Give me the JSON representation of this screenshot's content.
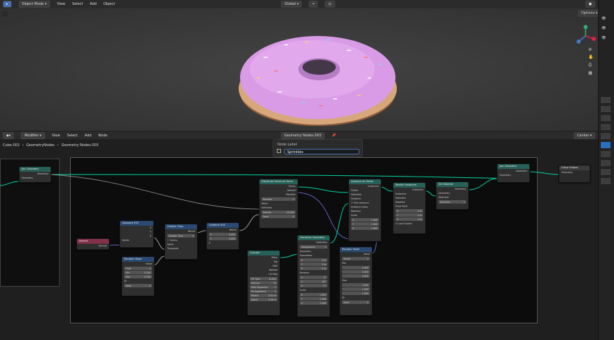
{
  "top_header": {
    "mode": "Object Mode",
    "menus": [
      "View",
      "Select",
      "Add",
      "Object"
    ],
    "transform": "Global",
    "options": "Options"
  },
  "node_header": {
    "editor": "Modifier",
    "menus": [
      "View",
      "Select",
      "Add",
      "Node"
    ],
    "tree_name": "Geometry Nodes.003",
    "pivot": "Center"
  },
  "breadcrumb": [
    "Cube.002",
    "GeometryNodes",
    "Geometry Nodes.003"
  ],
  "node_label_popup": {
    "title": "Node Label",
    "value": "Sprinkles"
  },
  "nodes": {
    "join1": {
      "title": "Join Geometry",
      "out": "Geometry",
      "in": "Geometry"
    },
    "normal": {
      "title": "Normal",
      "out": "Normal"
    },
    "sepxyz": {
      "title": "Separate XYZ",
      "outs": [
        "X",
        "Y",
        "Z"
      ],
      "in": "Vector"
    },
    "greater": {
      "title": "Greater Than",
      "out": "Result",
      "mode": "Greater Than",
      "clamp": "Clamp",
      "ins": [
        "Value",
        "Threshold"
      ]
    },
    "combine": {
      "title": "Combine XYZ",
      "out": "Vector",
      "x": "X",
      "xv": "0.000",
      "y": "Y",
      "yv": "0.000",
      "z": "Z"
    },
    "random": {
      "title": "Random Value",
      "out": "Value",
      "type": "Float",
      "min": "Min",
      "minv": "0.200",
      "max": "Max",
      "maxv": "0.500",
      "id": "ID",
      "seed": "Seed",
      "seedv": "0"
    },
    "distribute": {
      "title": "Distribute Points on Faces",
      "outs": [
        "Points",
        "Normal",
        "Rotation"
      ],
      "mode": "Random",
      "ins": [
        "Mesh",
        "Selection"
      ],
      "density": "Density",
      "densityv": "20.000",
      "seed": "Seed",
      "seedv": "0"
    },
    "cylinder": {
      "title": "Cylinder",
      "outs": [
        "Mesh",
        "Top",
        "Side",
        "Bottom",
        "UV Map"
      ],
      "fill": "Fill Type",
      "fillv": "N-Gon",
      "vertices": "Vertices",
      "verticesv": "10",
      "sides": "Side Segments",
      "sidesv": "1",
      "fillseg": "Fill Segments",
      "fillsegv": "1",
      "radius": "Radius",
      "radiusv": "0.01 m",
      "depth": "Depth",
      "depthv": "0.09 m"
    },
    "transform": {
      "title": "Transform Geometry",
      "out": "Geometry",
      "mode": "Components",
      "in": "Geometry",
      "translation": "Translation",
      "t": [
        "0 m",
        "0 m",
        "0 m"
      ],
      "rotation": "Rotation",
      "r": [
        "0°",
        "90°",
        "0°"
      ],
      "scale": "Scale",
      "s": [
        "1.000",
        "1.000",
        "1.000"
      ],
      "axes": [
        "X",
        "Y",
        "Z"
      ]
    },
    "instance": {
      "title": "Instance on Points",
      "out": "Instances",
      "ins": [
        "Points",
        "Selection",
        "Instance",
        "Pick Instance",
        "Instance Index",
        "Rotation",
        "Scale"
      ],
      "scale": [
        "1.000",
        "1.000",
        "1.000"
      ]
    },
    "random2": {
      "title": "Random Value",
      "out": "Value",
      "type": "Vector",
      "min": "Min",
      "minv": [
        "0.000",
        "0.000",
        "0.000"
      ],
      "max": "Max",
      "maxv": [
        "1.000",
        "1.000",
        "1.000"
      ],
      "id": "ID",
      "seed": "Seed",
      "seedv": "0"
    },
    "realize": {
      "title": "Realize Instances",
      "out": "Instances",
      "ins": [
        "Instances",
        "Selection",
        "Rotation",
        "Pivot Point"
      ],
      "pivot": [
        "0 m",
        "0 m",
        "0 m"
      ],
      "local": "Local Space"
    },
    "setmat": {
      "title": "Set Material",
      "out": "Geometry",
      "ins": [
        "Geometry",
        "Selection"
      ],
      "material": "Sprinkles"
    },
    "join2": {
      "title": "Join Geometry",
      "out": "Geometry",
      "in": "Geometry"
    },
    "output": {
      "title": "Group Output",
      "in": "Geometry"
    }
  },
  "colors": {
    "geometry": "#276058",
    "converter": "#2a4a73",
    "input": "#83314a",
    "donut": "#d99be6",
    "accent": "#4772b3"
  }
}
